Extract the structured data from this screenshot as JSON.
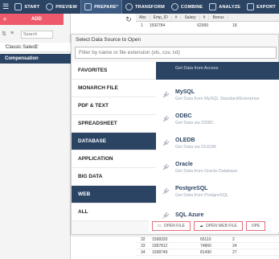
{
  "toolbar": {
    "items": [
      {
        "label": "START"
      },
      {
        "label": "PREVIEW"
      },
      {
        "label": "PREPARE*"
      },
      {
        "label": "TRANSFORM"
      },
      {
        "label": "COMBINE"
      },
      {
        "label": "ANALYZE"
      },
      {
        "label": "EXPORT"
      }
    ]
  },
  "leftpanel": {
    "add_label": "ADD",
    "search_placeholder": "Search",
    "workspaces": [
      {
        "label": "'Classic Sales$'"
      },
      {
        "label": "Compensation"
      }
    ]
  },
  "grid": {
    "headers": [
      "Abs",
      "Emp_ID",
      "#",
      "Salary",
      "#",
      "Bonus"
    ],
    "first_row": {
      "n": "1",
      "emp": "1592784",
      "salary": "62900",
      "bonus": "18"
    },
    "lower_rows": [
      {
        "n": "32",
        "emp": "1598320",
        "salary": "65110",
        "bonus": "2"
      },
      {
        "n": "33",
        "emp": "1587812",
        "salary": "74860",
        "bonus": "24"
      },
      {
        "n": "34",
        "emp": "1598749",
        "salary": "81490",
        "bonus": "27"
      }
    ]
  },
  "modal": {
    "title": "Select Data Source to Open",
    "filter_placeholder": "Filter by name or file extension (xls, csv, txt)",
    "categories": [
      {
        "label": "FAVORITES"
      },
      {
        "label": "MONARCH FILE"
      },
      {
        "label": "PDF & TEXT"
      },
      {
        "label": "SPREADSHEET"
      },
      {
        "label": "DATABASE"
      },
      {
        "label": "APPLICATION"
      },
      {
        "label": "BIG DATA"
      },
      {
        "label": "WEB"
      },
      {
        "label": "ALL"
      }
    ],
    "active_categories": [
      "DATABASE",
      "WEB"
    ],
    "sources": [
      {
        "name": "",
        "desc": "Get Data from Access"
      },
      {
        "name": "MySQL",
        "desc": "Get Data from MySQL Standard/Enterprise"
      },
      {
        "name": "ODBC",
        "desc": "Get Data via ODBC"
      },
      {
        "name": "OLEDB",
        "desc": "Get Data via OLEDB"
      },
      {
        "name": "Oracle",
        "desc": "Get Data from Oracle Database"
      },
      {
        "name": "PostgreSQL",
        "desc": "Get Data from PostgreSQL"
      },
      {
        "name": "SQL Azure",
        "desc": ""
      }
    ],
    "buttons": [
      {
        "label": "OPEN FILE"
      },
      {
        "label": "OPEN WEB FILE"
      },
      {
        "label": "OPE"
      }
    ]
  },
  "colors": {
    "navy": "#2b4464",
    "accent_red": "#ee5a6b"
  },
  "icons": {
    "menu": "hamburger-menu-icon",
    "refresh": "refresh-icon",
    "source": "plug-icon"
  }
}
